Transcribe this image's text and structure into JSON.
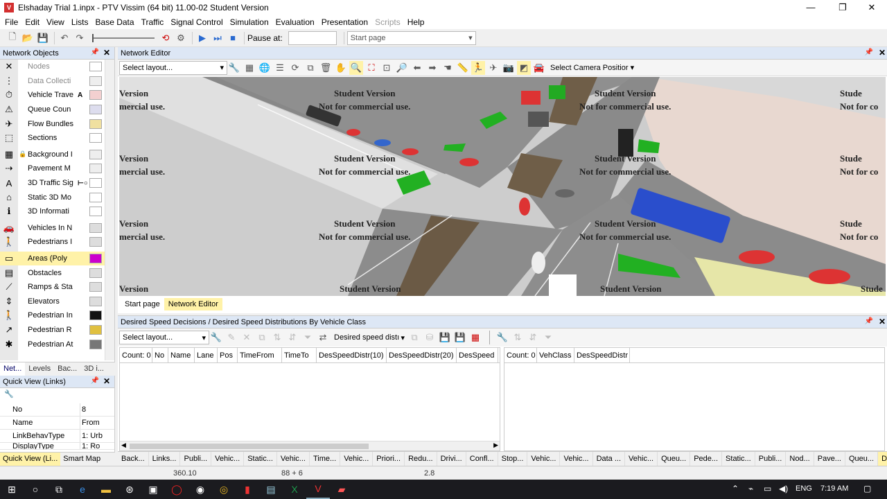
{
  "window": {
    "title": "Elshaday Trial 1.inpx - PTV Vissim (64 bit) 11.00-02 Student Version",
    "min": "—",
    "max": "❐",
    "close": "✕"
  },
  "menu": [
    "File",
    "Edit",
    "View",
    "Lists",
    "Base Data",
    "Traffic",
    "Signal Control",
    "Simulation",
    "Evaluation",
    "Presentation",
    "Scripts",
    "Help"
  ],
  "toolbar": {
    "pause_label": "Pause at:",
    "pause_value": "",
    "page_select": "Start page"
  },
  "network_objects": {
    "title": "Network Objects",
    "items": [
      {
        "label": "Nodes",
        "icon": "nodes-icon",
        "glyph": "✕",
        "disabled": true
      },
      {
        "label": "Data Collecti",
        "icon": "data-collection-icon",
        "glyph": "⋮",
        "disabled": true
      },
      {
        "label": "Vehicle Trave",
        "icon": "vehicle-travel-icon",
        "glyph": "⏱",
        "extra": "A"
      },
      {
        "label": "Queue Coun",
        "icon": "queue-counter-icon",
        "glyph": "⚠"
      },
      {
        "label": "Flow Bundles",
        "icon": "flow-bundles-icon",
        "glyph": "✈"
      },
      {
        "label": "Sections",
        "icon": "sections-icon",
        "glyph": "⬚"
      },
      {
        "label": "Background I",
        "icon": "background-image-icon",
        "glyph": "▦",
        "locked": true
      },
      {
        "label": "Pavement M",
        "icon": "pavement-marking-icon",
        "glyph": "⇢"
      },
      {
        "label": "3D Traffic Sig",
        "icon": "traffic-signal-3d-icon",
        "glyph": "A",
        "extra": "⊢○"
      },
      {
        "label": "Static 3D Mo",
        "icon": "static-3d-model-icon",
        "glyph": "⌂"
      },
      {
        "label": "3D Informati",
        "icon": "info-sign-3d-icon",
        "glyph": "ℹ"
      },
      {
        "label": "Vehicles In N",
        "icon": "vehicles-in-network-icon",
        "glyph": "🚗"
      },
      {
        "label": "Pedestrians I",
        "icon": "pedestrians-in-network-icon",
        "glyph": "🚶"
      },
      {
        "label": "Areas (Poly",
        "icon": "areas-polygon-icon",
        "glyph": "▭",
        "selected": true
      },
      {
        "label": "Obstacles",
        "icon": "obstacles-icon",
        "glyph": "▤"
      },
      {
        "label": "Ramps & Sta",
        "icon": "ramps-stairs-icon",
        "glyph": "⟋"
      },
      {
        "label": "Elevators",
        "icon": "elevators-icon",
        "glyph": "⇕"
      },
      {
        "label": "Pedestrian In",
        "icon": "pedestrian-input-icon",
        "glyph": "🚶"
      },
      {
        "label": "Pedestrian R",
        "icon": "pedestrian-route-icon",
        "glyph": "↗"
      },
      {
        "label": "Pedestrian At",
        "icon": "pedestrian-attraction-icon",
        "glyph": "✱"
      }
    ],
    "tabs": [
      "Net...",
      "Levels",
      "Bac...",
      "3D i..."
    ]
  },
  "quick_view": {
    "title": "Quick View (Links)",
    "rows": [
      {
        "k": "No",
        "v": "8"
      },
      {
        "k": "Name",
        "v": "From"
      },
      {
        "k": "LinkBehavType",
        "v": "1: Urb"
      },
      {
        "k": "DisplayType",
        "v": "1: Ro"
      }
    ],
    "tabs": [
      "Quick View (Li...",
      "Smart Map"
    ]
  },
  "editor": {
    "title": "Network Editor",
    "layout": "Select layout...",
    "camera": "Select Camera Positior",
    "tabs": [
      "Start page",
      "Network Editor"
    ],
    "watermark_l1": "Student Version",
    "watermark_l2": "Not for commercial use.",
    "frag_a": "Version",
    "frag_b": "mercial use.",
    "frag_c": "Stude",
    "frag_d": "Not for co"
  },
  "lists": {
    "title": "Desired Speed Decisions / Desired Speed Distributions By Vehicle Class",
    "layout": "Select layout...",
    "distr_select": "Desired speed distı",
    "left_cols": [
      "Count: 0",
      "No",
      "Name",
      "Lane",
      "Pos",
      "TimeFrom",
      "TimeTo",
      "DesSpeedDistr(10)",
      "DesSpeedDistr(20)",
      "DesSpeed"
    ],
    "right_cols": [
      "Count: 0",
      "VehClass",
      "DesSpeedDistr"
    ]
  },
  "bottom_tabs": [
    "Back...",
    "Links...",
    "Publi...",
    "Vehic...",
    "Static...",
    "Vehic...",
    "Time...",
    "Vehic...",
    "Priori...",
    "Redu...",
    "Drivi...",
    "Confl...",
    "Stop...",
    "Vehic...",
    "Vehic...",
    "Data ...",
    "Vehic...",
    "Queu...",
    "Pede...",
    "Static...",
    "Publi...",
    "Nod...",
    "Pave...",
    "Queu...",
    "Desir..."
  ],
  "status": {
    "coords": "360.10",
    "zoom": "88 + 6",
    "speed": "2.8"
  },
  "taskbar": {
    "lang": "ENG",
    "time": "7:19 AM"
  }
}
